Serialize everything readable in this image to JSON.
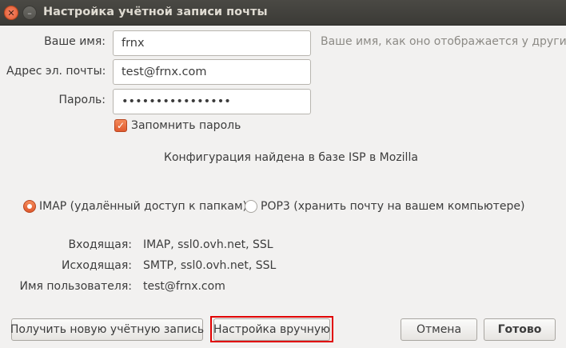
{
  "window": {
    "title": "Настройка учётной записи почты",
    "close_glyph": "✕",
    "minimize_glyph": "–"
  },
  "form": {
    "name_label": "Ваше имя:",
    "name_value": "frnx",
    "name_hint": "Ваше имя, как оно отображается у других",
    "email_label": "Адрес эл. почты:",
    "email_value": "test@frnx.com",
    "password_label": "Пароль:",
    "password_value": "••••••••••••••••",
    "remember_label": "Запомнить пароль",
    "remember_checked": true,
    "checkmark_glyph": "✓"
  },
  "status": "Конфигурация найдена в базе ISP в Mozilla",
  "protocols": {
    "imap_label": "IMAP (удалённый доступ к папкам)",
    "pop3_label": "POP3 (хранить почту на вашем компьютере)",
    "selected": "IMAP"
  },
  "summary": {
    "incoming_label": "Входящая:",
    "incoming_value": "IMAP, ssl0.ovh.net, SSL",
    "outgoing_label": "Исходящая:",
    "outgoing_value": "SMTP, ssl0.ovh.net, SSL",
    "username_label": "Имя пользователя:",
    "username_value": "test@frnx.com"
  },
  "buttons": {
    "new_account": "Получить новую учётную запись",
    "manual_config": "Настройка вручную",
    "cancel": "Отмена",
    "done": "Готово"
  },
  "colors": {
    "accent": "#e05a2e",
    "highlight": "#e00000",
    "titlebar": "#3c3b37"
  }
}
